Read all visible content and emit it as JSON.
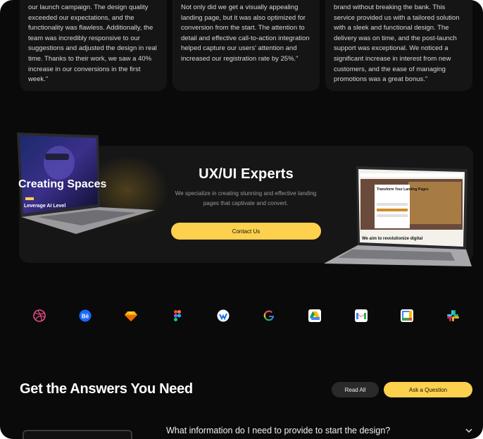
{
  "testimonials": [
    {
      "text": "our launch campaign. The design quality exceeded our expectations, and the functionality was flawless. Additionally, the team was incredibly responsive to our suggestions and adjusted the design in real time. Thanks to their work, we saw a 40% increase in our conversions in the first week.\""
    },
    {
      "text": "Not only did we get a visually appealing landing page, but it was also optimized for conversion from the start. The attention to detail and effective call-to-action integration helped capture our users' attention and increased our registration rate by 25%.\""
    },
    {
      "text": "brand without breaking the bank. This service provided us with a tailored solution with a sleek and functional design. The delivery was on time, and the post-launch support was exceptional. We noticed a significant increase in interest from new customers, and the ease of managing promotions was a great bonus.\""
    }
  ],
  "hero": {
    "title": "UX/UI Experts",
    "subtitle": "We specialize in creating stunning and effective landing pages that captivate and convert.",
    "cta": "Contact Us"
  },
  "laptop_left": {
    "headline": "Creating Spaces",
    "badge": "Leverage AI Level"
  },
  "laptop_right": {
    "headline": "Transform Your Landing Pages",
    "footer": "We aim to revolutionize digital"
  },
  "logos": [
    "dribbble-icon",
    "behance-icon",
    "sketch-icon",
    "figma-icon",
    "webflow-icon",
    "google-icon",
    "google-drive-icon",
    "gmail-icon",
    "google-calendar-icon",
    "slack-icon"
  ],
  "faq": {
    "title": "Get the Answers You Need",
    "read_all": "Read All",
    "ask": "Ask a Question",
    "question": "What information do I need to provide to start the design?"
  },
  "colors": {
    "accent": "#fdd14d",
    "background": "#0a0a0a",
    "card": "#151515"
  }
}
